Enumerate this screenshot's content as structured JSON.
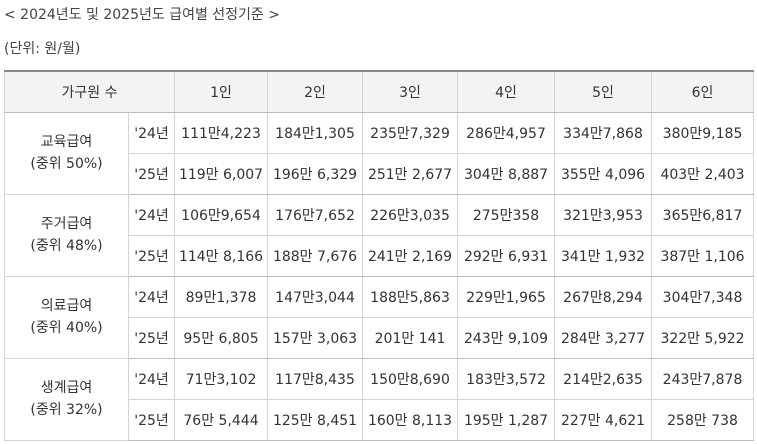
{
  "title": "< 2024년도 및 2025년도 급여별 선정기준 >",
  "unit": "(단위: 원/월)",
  "header": {
    "household_label": "가구원 수",
    "sizes": [
      "1인",
      "2인",
      "3인",
      "4인",
      "5인",
      "6인"
    ]
  },
  "groups": [
    {
      "name": "교육급여",
      "ratio": "(중위 50%)",
      "rows": [
        {
          "year": "'24년",
          "values": [
            "111만4,223",
            "184만1,305",
            "235만7,329",
            "286만4,957",
            "334만7,868",
            "380만9,185"
          ]
        },
        {
          "year": "'25년",
          "values": [
            "119만 6,007",
            "196만 6,329",
            "251만 2,677",
            "304만 8,887",
            "355만 4,096",
            "403만 2,403"
          ]
        }
      ]
    },
    {
      "name": "주거급여",
      "ratio": "(중위 48%)",
      "rows": [
        {
          "year": "'24년",
          "values": [
            "106만9,654",
            "176만7,652",
            "226만3,035",
            "275만358",
            "321만3,953",
            "365만6,817"
          ]
        },
        {
          "year": "'25년",
          "values": [
            "114만 8,166",
            "188만 7,676",
            "241만 2,169",
            "292만 6,931",
            "341만 1,932",
            "387만 1,106"
          ]
        }
      ]
    },
    {
      "name": "의료급여",
      "ratio": "(중위 40%)",
      "rows": [
        {
          "year": "'24년",
          "values": [
            "89만1,378",
            "147만3,044",
            "188만5,863",
            "229만1,965",
            "267만8,294",
            "304만7,348"
          ]
        },
        {
          "year": "'25년",
          "values": [
            "95만 6,805",
            "157만 3,063",
            "201만 141",
            "243만 9,109",
            "284만 3,277",
            "322만 5,922"
          ]
        }
      ]
    },
    {
      "name": "생계급여",
      "ratio": "(중위 32%)",
      "rows": [
        {
          "year": "'24년",
          "values": [
            "71만3,102",
            "117만8,435",
            "150만8,690",
            "183만3,572",
            "214만2,635",
            "243만7,878"
          ]
        },
        {
          "year": "'25년",
          "values": [
            "76만 5,444",
            "125만 8,451",
            "160만 8,113",
            "195만 1,287",
            "227만 4,621",
            "258만 738"
          ]
        }
      ]
    }
  ]
}
